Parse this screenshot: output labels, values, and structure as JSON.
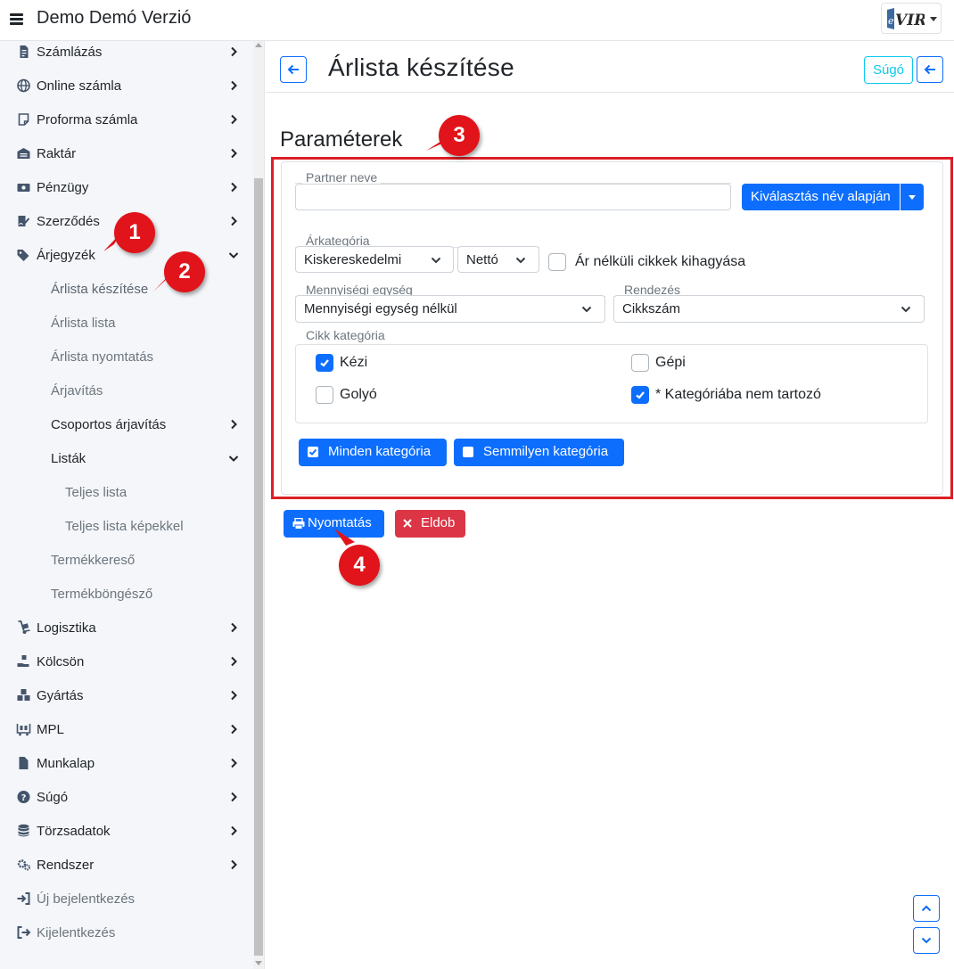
{
  "topbar": {
    "app_title": "Demo Demó Verzió",
    "logo_text": "eVIR",
    "menu_icon": "hamburger-icon"
  },
  "sidebar": {
    "items": [
      {
        "label": "Számlázás",
        "icon": "invoice-icon"
      },
      {
        "label": "Online számla",
        "icon": "globe-icon"
      },
      {
        "label": "Proforma számla",
        "icon": "note-icon"
      },
      {
        "label": "Raktár",
        "icon": "warehouse-icon"
      },
      {
        "label": "Pénzügy",
        "icon": "money-icon"
      },
      {
        "label": "Szerződés",
        "icon": "contract-icon"
      },
      {
        "label": "Árjegyzék",
        "icon": "tags-icon",
        "expanded": true
      },
      {
        "label": "Árlista készítése",
        "active": true
      },
      {
        "label": "Árlista lista"
      },
      {
        "label": "Árlista nyomtatás"
      },
      {
        "label": "Árjavítás"
      },
      {
        "label": "Csoportos árjavítás"
      },
      {
        "label": "Listák",
        "expanded": true
      },
      {
        "label": "Teljes lista"
      },
      {
        "label": "Teljes lista képekkel"
      },
      {
        "label": "Termékkereső"
      },
      {
        "label": "Termékböngésző"
      },
      {
        "label": "Logisztika",
        "icon": "dolly-icon"
      },
      {
        "label": "Kölcsön",
        "icon": "hand-holding-icon"
      },
      {
        "label": "Gyártás",
        "icon": "cubes-icon"
      },
      {
        "label": "MPL",
        "icon": "pallet-icon"
      },
      {
        "label": "Munkalap",
        "icon": "file-icon"
      },
      {
        "label": "Súgó",
        "icon": "question-circle-icon"
      },
      {
        "label": "Törzsadatok",
        "icon": "database-icon"
      },
      {
        "label": "Rendszer",
        "icon": "cogs-icon"
      },
      {
        "label": "Új bejelentkezés",
        "icon": "sign-in-icon"
      },
      {
        "label": "Kijelentkezés",
        "icon": "sign-out-icon"
      }
    ]
  },
  "header": {
    "title": "Árlista készítése",
    "help_label": "Súgó"
  },
  "params": {
    "section_title": "Paraméterek",
    "partner_label": "Partner neve",
    "partner_value": "",
    "select_by_name_label": "Kiválasztás név alapján",
    "price_category_label": "Árkategória",
    "price_category_value": "Kiskereskedelmi",
    "net_gross_value": "Nettó",
    "skip_no_price_label": "Ár nélküli cikkek kihagyása",
    "skip_no_price_checked": false,
    "unit_label": "Mennyiségi egység",
    "unit_value": "Mennyiségi egység nélkül",
    "sort_label": "Rendezés",
    "sort_value": "Cikkszám",
    "item_category_label": "Cikk kategória",
    "categories": [
      {
        "label": "Kézi",
        "checked": true
      },
      {
        "label": "Gépi",
        "checked": false
      },
      {
        "label": "Golyó",
        "checked": false
      },
      {
        "label": "* Kategóriába nem tartozó",
        "checked": true
      }
    ],
    "all_categories_label": "Minden kategória",
    "no_categories_label": "Semmilyen kategória"
  },
  "actions": {
    "print_label": "Nyomtatás",
    "discard_label": "Eldob"
  },
  "callouts": [
    "1",
    "2",
    "3",
    "4"
  ],
  "colors": {
    "primary": "#0d6efd",
    "danger": "#dc3545",
    "info": "#0dcaf0",
    "callout": "#e0141a",
    "sidebar_bg": "#f4f6fa"
  }
}
